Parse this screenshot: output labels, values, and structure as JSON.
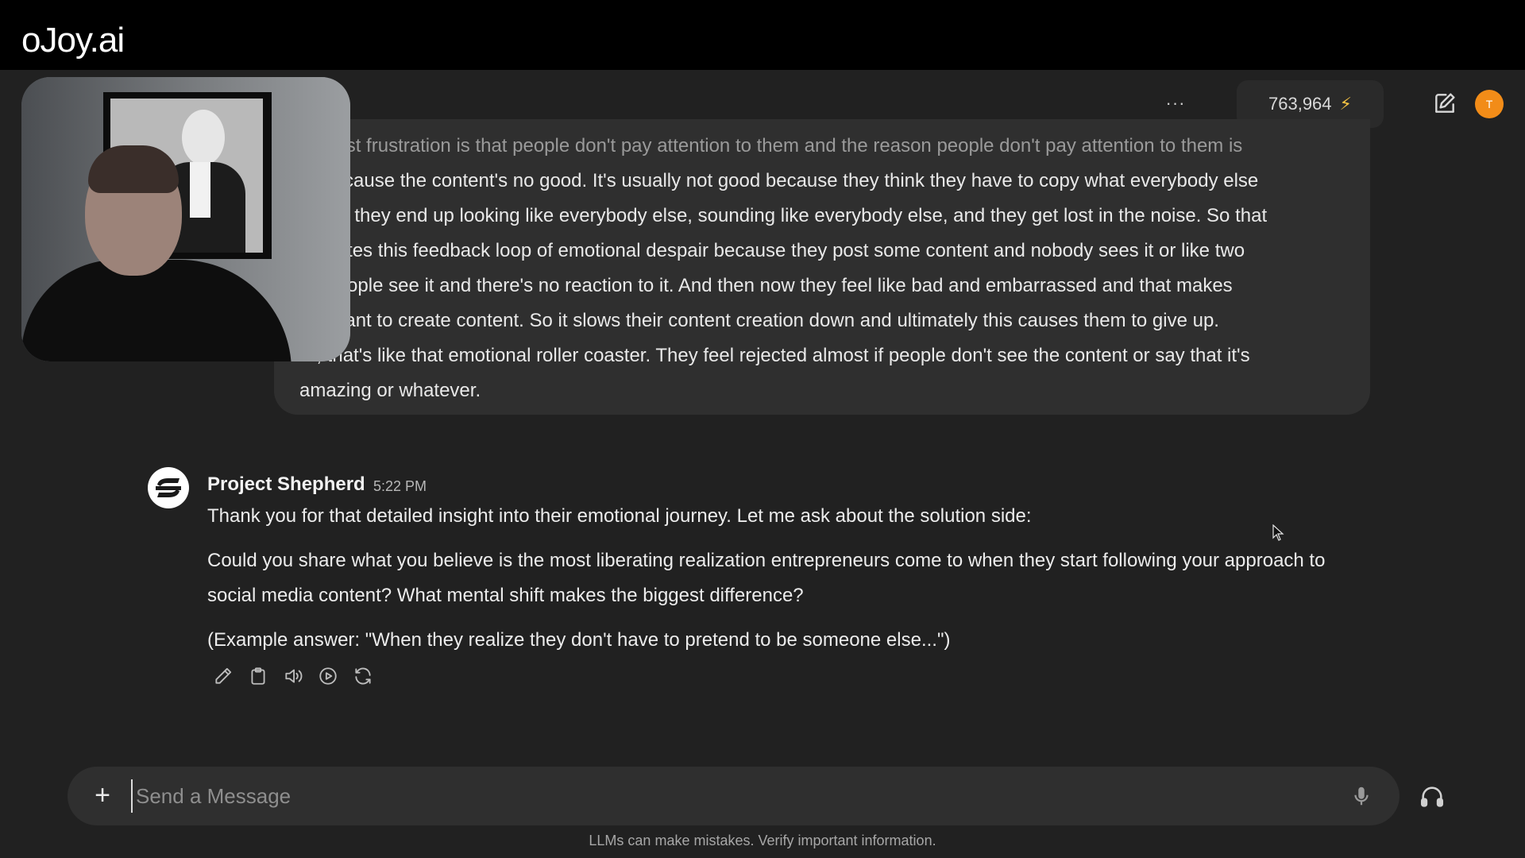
{
  "app": {
    "logo_text": "oJoy.ai"
  },
  "header": {
    "more_label": "···",
    "credits_value": "763,964",
    "credits_icon": "lightning-bolt-icon",
    "avatar_initial": "T",
    "colors": {
      "avatar": "#f28c18",
      "bolt": "#f6c342"
    }
  },
  "user_message": {
    "lines_faded": "biggest frustration is that people don't pay attention to them and the reason people don't pay attention to them is",
    "lines": [
      "lly because the content's no good. It's usually not good because they think they have to copy what everybody else",
      "ıg. So they end up looking like everybody else, sounding like everybody else, and they get lost in the noise. So that",
      "f creates this feedback loop of emotional despair because they post some content and nobody sees it or like two",
      "ee people see it and there's no reaction to it. And then now they feel like bad and embarrassed and that makes",
      "not want to create content. So it slows their content creation down and ultimately this causes them to give up.",
      "ɹn, that's like that emotional roller coaster. They feel rejected almost if people don't see the content or say that it's",
      "amazing or whatever."
    ]
  },
  "assistant_message": {
    "name": "Project Shepherd",
    "time": "5:22 PM",
    "paragraph_1": "Thank you for that detailed insight into their emotional journey. Let me ask about the solution side:",
    "paragraph_2": "Could you share what you believe is the most liberating realization entrepreneurs come to when they start following your approach to social media content? What mental shift makes the biggest difference?",
    "paragraph_3": "(Example answer: \"When they realize they don't have to pretend to be someone else...\")",
    "actions": [
      "edit-icon",
      "copy-icon",
      "speaker-icon",
      "play-icon",
      "regenerate-icon"
    ]
  },
  "composer": {
    "placeholder": "Send a Message",
    "value": ""
  },
  "footer": {
    "disclaimer": "LLMs can make mistakes. Verify important information."
  }
}
